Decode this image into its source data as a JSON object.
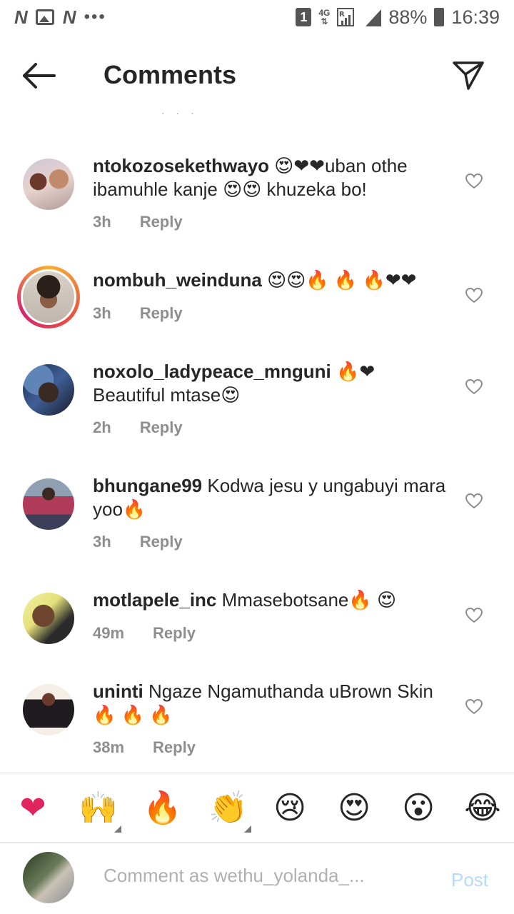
{
  "status_bar": {
    "left_icons": [
      "N",
      "image",
      "N",
      "more"
    ],
    "sim_badge": "1",
    "network": "4G",
    "roaming": "R",
    "battery": "88%",
    "time": "16:39"
  },
  "header": {
    "title": "Comments",
    "back_icon": "arrow-left-icon",
    "share_icon": "send-icon"
  },
  "comments": [
    {
      "username": "ntokozosekethwayo",
      "text": " 😍❤❤uban othe ibamuhle kanje 😍😍 khuzeka bo!",
      "time": "3h",
      "reply": "Reply"
    },
    {
      "username": "nombuh_weinduna",
      "text": " 😍😍🔥 🔥 🔥❤❤",
      "time": "3h",
      "reply": "Reply"
    },
    {
      "username": "noxolo_ladypeace_mnguni",
      "text": " 🔥❤ Beautiful mtase😍",
      "time": "2h",
      "reply": "Reply"
    },
    {
      "username": "bhungane99",
      "text": " Kodwa jesu y ungabuyi mara yoo🔥",
      "time": "3h",
      "reply": "Reply"
    },
    {
      "username": "motlapele_inc",
      "text": " Mmasebotsane🔥 😍",
      "time": "49m",
      "reply": "Reply"
    },
    {
      "username": "uninti",
      "text": " Ngaze Ngamuthanda uBrown Skin🔥 🔥 🔥",
      "time": "38m",
      "reply": "Reply"
    }
  ],
  "emoji_bar": [
    "❤",
    "🙌",
    "🔥",
    "👏",
    "😢",
    "😍",
    "😮",
    "😂"
  ],
  "composer": {
    "placeholder": "Comment as wethu_yolanda_...",
    "post_label": "Post"
  },
  "colors": {
    "text": "#262626",
    "meta": "#8e8e8e",
    "post_disabled": "#b3dbff",
    "divider": "#dbdbdb"
  }
}
